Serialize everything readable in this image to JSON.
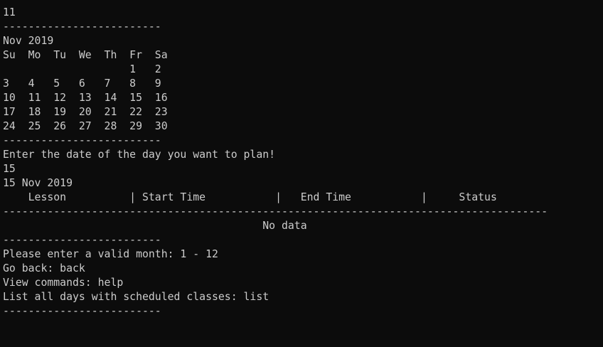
{
  "console": {
    "lines": [
      "-------------------------",
      "11",
      "-------------------------",
      "Nov 2019",
      "Su  Mo  Tu  We  Th  Fr  Sa",
      "                    1   2",
      "3   4   5   6   7   8   9",
      "10  11  12  13  14  15  16",
      "17  18  19  20  21  22  23",
      "24  25  26  27  28  29  30",
      "-------------------------",
      "Enter the date of the day you want to plan!",
      "15",
      "15 Nov 2019",
      "    Lesson          | Start Time           |   End Time           |     Status",
      "--------------------------------------------------------------------------------------",
      "                                         No data",
      "-------------------------",
      "Please enter a valid month: 1 - 12",
      "Go back: back",
      "View commands: help",
      "List all days with scheduled classes: list",
      "-------------------------"
    ]
  }
}
